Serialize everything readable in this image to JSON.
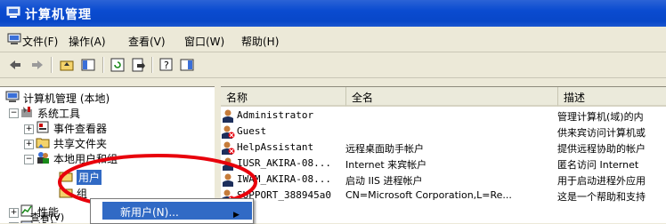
{
  "window": {
    "title": "计算机管理"
  },
  "menubar": {
    "items": [
      "文件(F)",
      "操作(A)",
      "查看(V)",
      "窗口(W)",
      "帮助(H)"
    ]
  },
  "toolbar": {
    "icons": [
      "back-icon",
      "forward-icon",
      "up-folder-icon",
      "show-tree-icon",
      "refresh-icon",
      "export-icon",
      "help-icon",
      "console-icon"
    ]
  },
  "tree": {
    "root": "计算机管理 (本地)",
    "system_tools": "系统工具",
    "event_viewer": "事件查看器",
    "shared_folders": "共享文件夹",
    "local_users": "本地用户和组",
    "users": "用户",
    "groups": "组",
    "performance": "性能",
    "device": "设备"
  },
  "list": {
    "columns": [
      "名称",
      "全名",
      "描述"
    ],
    "rows": [
      {
        "name": "Administrator",
        "full": "",
        "desc": "管理计算机(域)的内",
        "disabled": false
      },
      {
        "name": "Guest",
        "full": "",
        "desc": "供来宾访问计算机或",
        "disabled": true
      },
      {
        "name": "HelpAssistant",
        "full": "远程桌面助手帐户",
        "desc": "提供远程协助的帐户",
        "disabled": true
      },
      {
        "name": "IUSR_AKIRA-08...",
        "full": "Internet 来宾帐户",
        "desc": "匿名访问 Internet",
        "disabled": false
      },
      {
        "name": "IWAM_AKIRA-08...",
        "full": "启动 IIS 进程帐户",
        "desc": "用于启动进程外应用",
        "disabled": false
      },
      {
        "name": "SUPPORT_388945a0",
        "full": "CN=Microsoft Corporation,L=Re...",
        "desc": "这是一个帮助和支持",
        "disabled": true
      }
    ]
  },
  "context_menu": {
    "new_user": "新用户(N)...",
    "view": "查看(V)"
  },
  "colors": {
    "title": "#0a4bd0",
    "selection": "#316ac5",
    "highlight_ring": "#e8000b"
  }
}
